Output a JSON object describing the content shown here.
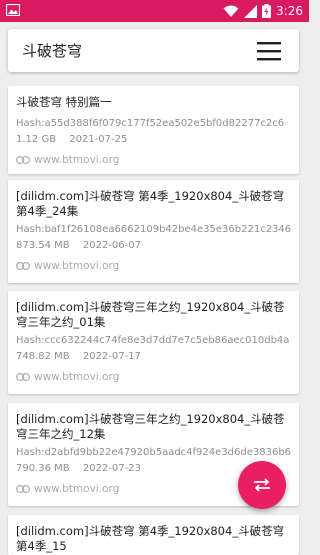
{
  "status_bar": {
    "time": "3:26",
    "icons": [
      "image-icon",
      "wifi-icon",
      "signal-icon",
      "battery-icon"
    ]
  },
  "app_bar": {
    "title": "斗破苍穹",
    "menu_icon": "hamburger-menu-icon"
  },
  "results": [
    {
      "name": "斗破苍穹 特别篇一",
      "hash": "Hash:a55d388f6f079c177f52ea502e5bf0d82277c2c6",
      "size": "1.12 GB",
      "date": "2021-07-25",
      "site": "www.btmovi.org"
    },
    {
      "name": "[dilidm.com]斗破苍穹 第4季_1920x804_斗破苍穹第4季_24集",
      "hash": "Hash:baf1f26108ea6662109b42be4e35e36b221c2346",
      "size": "873.54 MB",
      "date": "2022-06-07",
      "site": "www.btmovi.org"
    },
    {
      "name": "[dilidm.com]斗破苍穹三年之约_1920x804_斗破苍穹三年之约_01集",
      "hash": "Hash:ccc632244c74fe8e3d7dd7e7c5eb86aec010db4a",
      "size": "748.82 MB",
      "date": "2022-07-17",
      "site": "www.btmovi.org"
    },
    {
      "name": "[dilidm.com]斗破苍穹三年之约_1920x804_斗破苍穹三年之约_12集",
      "hash": "Hash:d2abfd9bb22e47920b5aadc4f924e3d6de3836b6",
      "size": "790.36 MB",
      "date": "2022-07-23",
      "site": "www.btmovi.org"
    },
    {
      "name": "[dilidm.com]斗破苍穹 第4季_1920x804_斗破苍穹第4季_15",
      "hash": "",
      "size": "",
      "date": "",
      "site": ""
    }
  ],
  "fab": {
    "icon": "swap-arrows-icon"
  },
  "colors": {
    "status_bar": "#d81b60",
    "fab": "#e91e63",
    "background": "#eeeeee"
  }
}
